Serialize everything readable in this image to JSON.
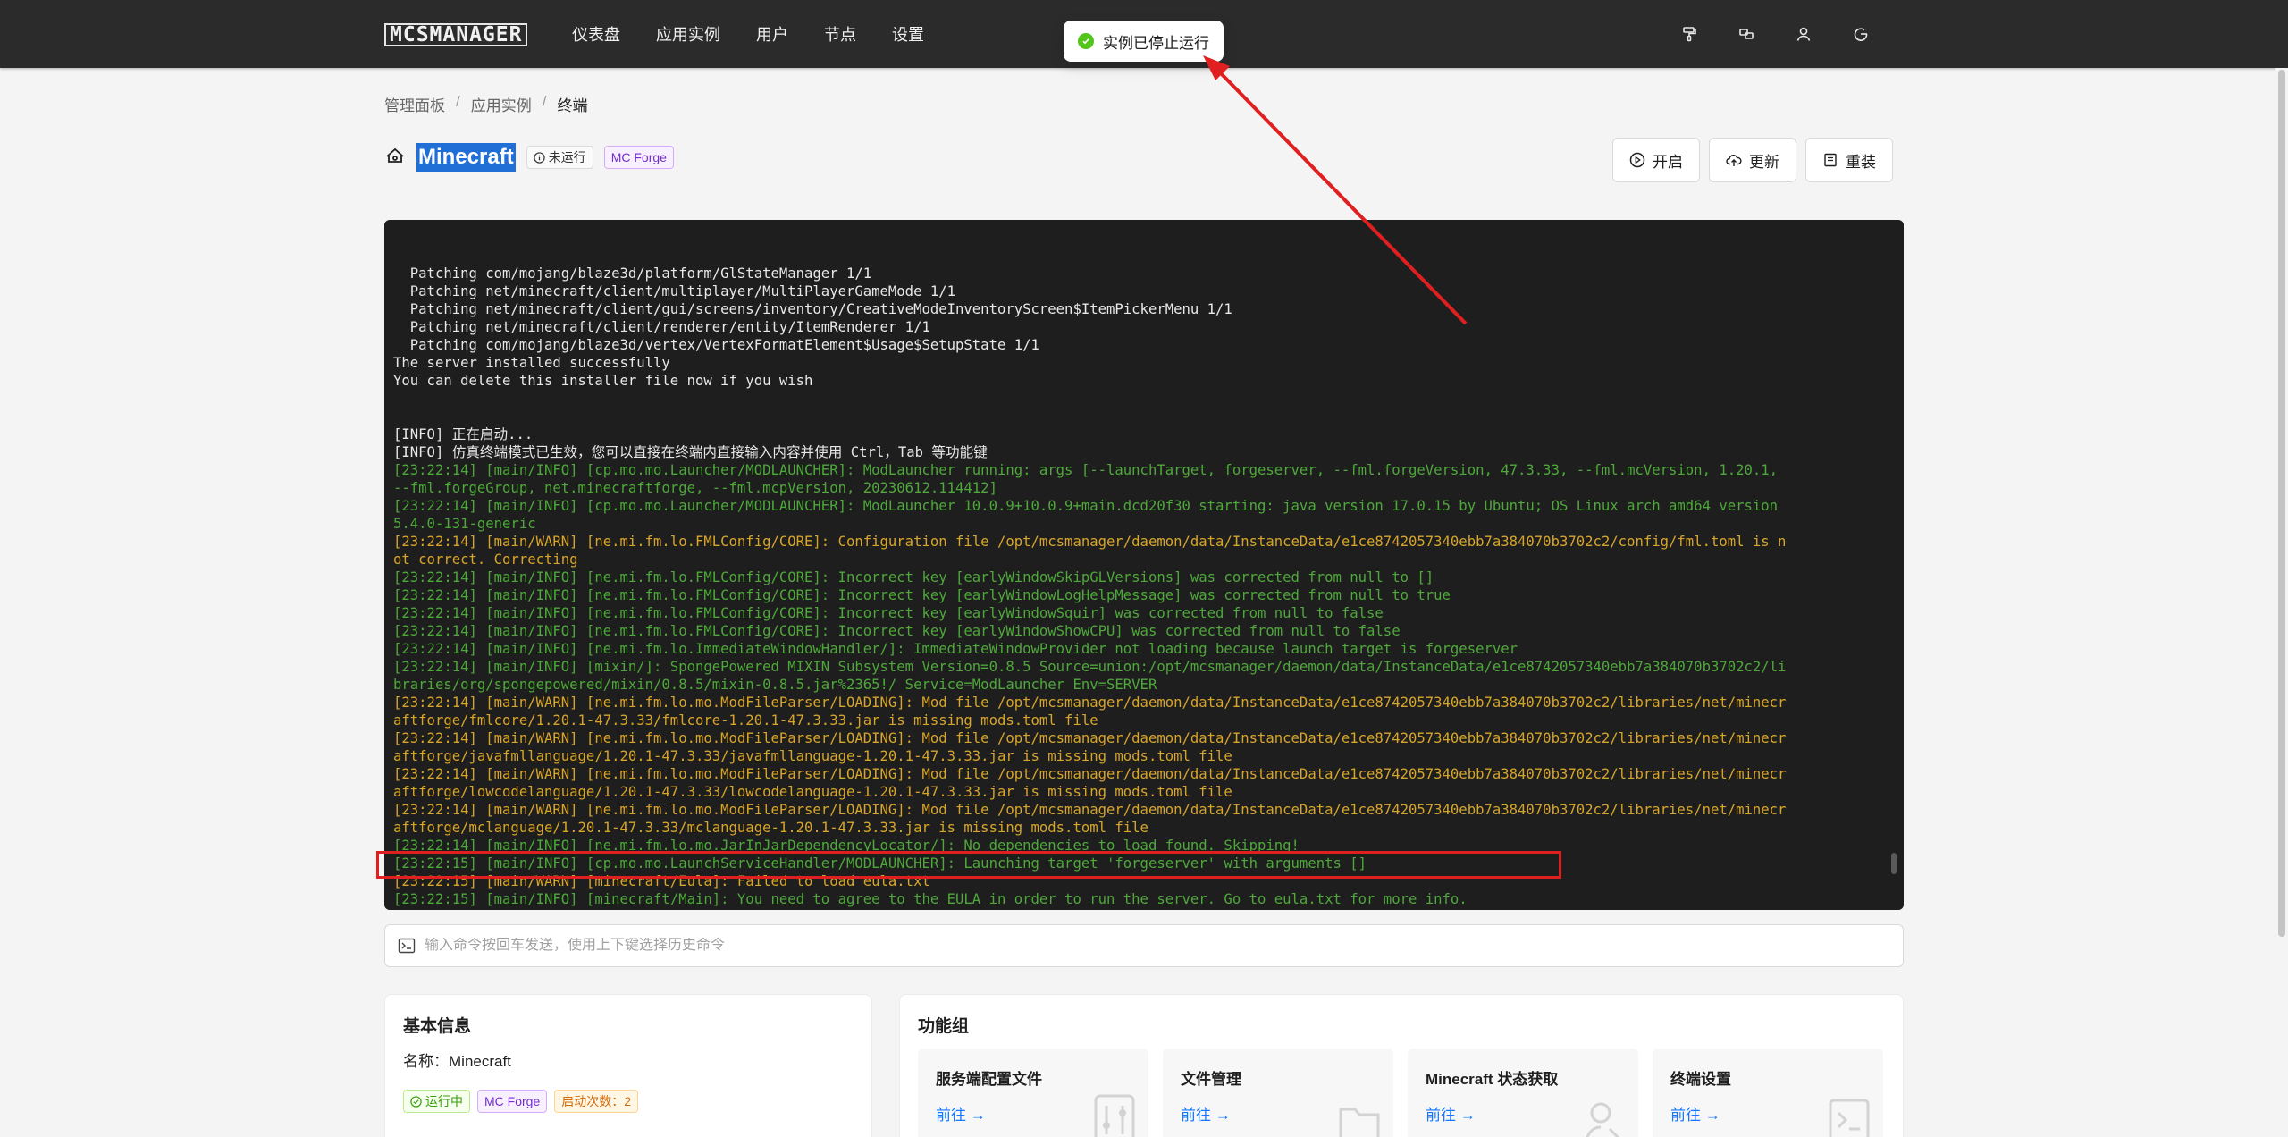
{
  "nav": {
    "logo": "MCSMANAGER",
    "items": [
      "仪表盘",
      "应用实例",
      "用户",
      "节点",
      "设置"
    ]
  },
  "toast": {
    "text": "实例已停止运行"
  },
  "breadcrumb": {
    "items": [
      "管理面板",
      "应用实例",
      "终端"
    ],
    "separator": "/"
  },
  "instance": {
    "name": "Minecraft",
    "status": "未运行",
    "type": "MC Forge"
  },
  "actions": {
    "start": "开启",
    "update": "更新",
    "reinstall": "重装"
  },
  "terminal": {
    "lines": [
      {
        "c": "white",
        "t": "  Patching com/mojang/blaze3d/platform/GlStateManager 1/1"
      },
      {
        "c": "white",
        "t": "  Patching net/minecraft/client/multiplayer/MultiPlayerGameMode 1/1"
      },
      {
        "c": "white",
        "t": "  Patching net/minecraft/client/gui/screens/inventory/CreativeModeInventoryScreen$ItemPickerMenu 1/1"
      },
      {
        "c": "white",
        "t": "  Patching net/minecraft/client/renderer/entity/ItemRenderer 1/1"
      },
      {
        "c": "white",
        "t": "  Patching com/mojang/blaze3d/vertex/VertexFormatElement$Usage$SetupState 1/1"
      },
      {
        "c": "white",
        "t": "The server installed successfully"
      },
      {
        "c": "white",
        "t": "You can delete this installer file now if you wish"
      },
      {
        "c": "blank",
        "t": " "
      },
      {
        "c": "blank",
        "t": " "
      },
      {
        "c": "white",
        "t": "[INFO] 正在启动..."
      },
      {
        "c": "white",
        "t": "[INFO] 仿真终端模式已生效，您可以直接在终端内直接输入内容并使用 Ctrl，Tab 等功能键"
      },
      {
        "c": "green",
        "t": "[23:22:14] [main/INFO] [cp.mo.mo.Launcher/MODLAUNCHER]: ModLauncher running: args [--launchTarget, forgeserver, --fml.forgeVersion, 47.3.33, --fml.mcVersion, 1.20.1,"
      },
      {
        "c": "green",
        "t": "--fml.forgeGroup, net.minecraftforge, --fml.mcpVersion, 20230612.114412]"
      },
      {
        "c": "green",
        "t": "[23:22:14] [main/INFO] [cp.mo.mo.Launcher/MODLAUNCHER]: ModLauncher 10.0.9+10.0.9+main.dcd20f30 starting: java version 17.0.15 by Ubuntu; OS Linux arch amd64 version"
      },
      {
        "c": "green",
        "t": "5.4.0-131-generic"
      },
      {
        "c": "yellow",
        "t": "[23:22:14] [main/WARN] [ne.mi.fm.lo.FMLConfig/CORE]: Configuration file /opt/mcsmanager/daemon/data/InstanceData/e1ce8742057340ebb7a384070b3702c2/config/fml.toml is n"
      },
      {
        "c": "yellow",
        "t": "ot correct. Correcting"
      },
      {
        "c": "green",
        "t": "[23:22:14] [main/INFO] [ne.mi.fm.lo.FMLConfig/CORE]: Incorrect key [earlyWindowSkipGLVersions] was corrected from null to []"
      },
      {
        "c": "green",
        "t": "[23:22:14] [main/INFO] [ne.mi.fm.lo.FMLConfig/CORE]: Incorrect key [earlyWindowLogHelpMessage] was corrected from null to true"
      },
      {
        "c": "green",
        "t": "[23:22:14] [main/INFO] [ne.mi.fm.lo.FMLConfig/CORE]: Incorrect key [earlyWindowSquir] was corrected from null to false"
      },
      {
        "c": "green",
        "t": "[23:22:14] [main/INFO] [ne.mi.fm.lo.FMLConfig/CORE]: Incorrect key [earlyWindowShowCPU] was corrected from null to false"
      },
      {
        "c": "green",
        "t": "[23:22:14] [main/INFO] [ne.mi.fm.lo.ImmediateWindowHandler/]: ImmediateWindowProvider not loading because launch target is forgeserver"
      },
      {
        "c": "green",
        "t": "[23:22:14] [main/INFO] [mixin/]: SpongePowered MIXIN Subsystem Version=0.8.5 Source=union:/opt/mcsmanager/daemon/data/InstanceData/e1ce8742057340ebb7a384070b3702c2/li"
      },
      {
        "c": "green",
        "t": "braries/org/spongepowered/mixin/0.8.5/mixin-0.8.5.jar%2365!/ Service=ModLauncher Env=SERVER"
      },
      {
        "c": "yellow",
        "t": "[23:22:14] [main/WARN] [ne.mi.fm.lo.mo.ModFileParser/LOADING]: Mod file /opt/mcsmanager/daemon/data/InstanceData/e1ce8742057340ebb7a384070b3702c2/libraries/net/minecr"
      },
      {
        "c": "yellow",
        "t": "aftforge/fmlcore/1.20.1-47.3.33/fmlcore-1.20.1-47.3.33.jar is missing mods.toml file"
      },
      {
        "c": "yellow",
        "t": "[23:22:14] [main/WARN] [ne.mi.fm.lo.mo.ModFileParser/LOADING]: Mod file /opt/mcsmanager/daemon/data/InstanceData/e1ce8742057340ebb7a384070b3702c2/libraries/net/minecr"
      },
      {
        "c": "yellow",
        "t": "aftforge/javafmllanguage/1.20.1-47.3.33/javafmllanguage-1.20.1-47.3.33.jar is missing mods.toml file"
      },
      {
        "c": "yellow",
        "t": "[23:22:14] [main/WARN] [ne.mi.fm.lo.mo.ModFileParser/LOADING]: Mod file /opt/mcsmanager/daemon/data/InstanceData/e1ce8742057340ebb7a384070b3702c2/libraries/net/minecr"
      },
      {
        "c": "yellow",
        "t": "aftforge/lowcodelanguage/1.20.1-47.3.33/lowcodelanguage-1.20.1-47.3.33.jar is missing mods.toml file"
      },
      {
        "c": "yellow",
        "t": "[23:22:14] [main/WARN] [ne.mi.fm.lo.mo.ModFileParser/LOADING]: Mod file /opt/mcsmanager/daemon/data/InstanceData/e1ce8742057340ebb7a384070b3702c2/libraries/net/minecr"
      },
      {
        "c": "yellow",
        "t": "aftforge/mclanguage/1.20.1-47.3.33/mclanguage-1.20.1-47.3.33.jar is missing mods.toml file"
      },
      {
        "c": "green",
        "t": "[23:22:14] [main/INFO] [ne.mi.fm.lo.mo.JarInJarDependencyLocator/]: No dependencies to load found. Skipping!"
      },
      {
        "c": "green",
        "t": "[23:22:15] [main/INFO] [cp.mo.mo.LaunchServiceHandler/MODLAUNCHER]: Launching target 'forgeserver' with arguments []"
      },
      {
        "c": "yellow",
        "t": "[23:22:15] [main/WARN] [minecraft/Eula]: Failed to load eula.txt"
      },
      {
        "c": "green",
        "t": "[23:22:15] [main/INFO] [minecraft/Main]: You need to agree to the EULA in order to run the server. Go to eula.txt for more info."
      }
    ]
  },
  "command": {
    "placeholder": "输入命令按回车发送，使用上下键选择历史命令"
  },
  "basic_info": {
    "title": "基本信息",
    "name_line": "名称：Minecraft",
    "status_tag": "运行中",
    "type_tag": "MC Forge",
    "start_count_tag": "启动次数：2"
  },
  "function_group": {
    "title": "功能组",
    "items": [
      {
        "name": "服务端配置文件",
        "link": "前往 →",
        "icon": "settings-sliders-icon"
      },
      {
        "name": "文件管理",
        "link": "前往 →",
        "icon": "folder-icon"
      },
      {
        "name": "Minecraft 状态获取",
        "link": "前往 →",
        "icon": "search-user-icon"
      },
      {
        "name": "终端设置",
        "link": "前往 →",
        "icon": "terminal-icon"
      }
    ]
  },
  "colors": {
    "nav_bg": "#2b2b2b",
    "terminal_bg": "#1e1e1e",
    "terminal_green": "#4ea83a",
    "terminal_yellow": "#d7a52a",
    "annotation_red": "#e02020",
    "link_blue": "#1677ff"
  }
}
